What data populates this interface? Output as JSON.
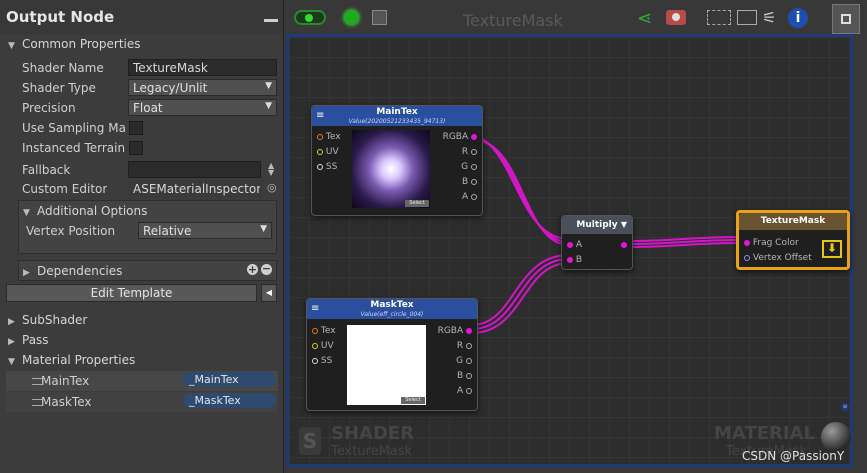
{
  "panel": {
    "title": "Output Node",
    "common_properties": "Common Properties",
    "shader_name_label": "Shader Name",
    "shader_name_value": "TextureMask",
    "shader_type_label": "Shader Type",
    "shader_type_value": "Legacy/Unlit",
    "precision_label": "Precision",
    "precision_value": "Float",
    "use_sampling_label": "Use Sampling Mac",
    "instanced_terrain_label": "Instanced Terrain",
    "fallback_label": "Fallback",
    "fallback_value": "",
    "custom_editor_label": "Custom Editor",
    "custom_editor_value": "ASEMaterialInspector",
    "additional_options": "Additional Options",
    "vertex_position_label": "Vertex Position",
    "vertex_position_value": "Relative",
    "dependencies": "Dependencies",
    "edit_template": "Edit Template",
    "subshader": "SubShader",
    "pass": "Pass",
    "material_properties": "Material Properties",
    "props": [
      {
        "name": "MainTex",
        "value": "_MainTex"
      },
      {
        "name": "MaskTex",
        "value": "_MaskTex"
      }
    ]
  },
  "graph": {
    "title": "TextureMask",
    "nodes": {
      "maintex": {
        "title": "MainTex",
        "subtitle": "Value(20200521233435_94713)",
        "inputs": [
          "Tex",
          "UV",
          "SS"
        ],
        "outputs": [
          "RGBA",
          "R",
          "G",
          "B",
          "A"
        ],
        "select": "Select"
      },
      "masktex": {
        "title": "MaskTex",
        "subtitle": "Value(eff_circle_004)",
        "inputs": [
          "Tex",
          "UV",
          "SS"
        ],
        "outputs": [
          "RGBA",
          "R",
          "G",
          "B",
          "A"
        ],
        "select": "Select"
      },
      "multiply": {
        "title": "Multiply",
        "inputs": [
          "A",
          "B"
        ]
      },
      "output": {
        "title": "TextureMask",
        "inputs": [
          "Frag Color",
          "Vertex Offset"
        ]
      }
    },
    "watermark_shader": "SHADER",
    "watermark_shader_sub": "TextureMask",
    "watermark_material": "MATERIAL",
    "watermark_material_sub": "TextureMask"
  },
  "credit": "CSDN @PassionY",
  "colors": {
    "connection": "#e514d9",
    "graph_border": "#1e3a78",
    "node_header": "#2a4f9e",
    "output_header": "#8a6a2a",
    "output_border": "#e8a317"
  }
}
